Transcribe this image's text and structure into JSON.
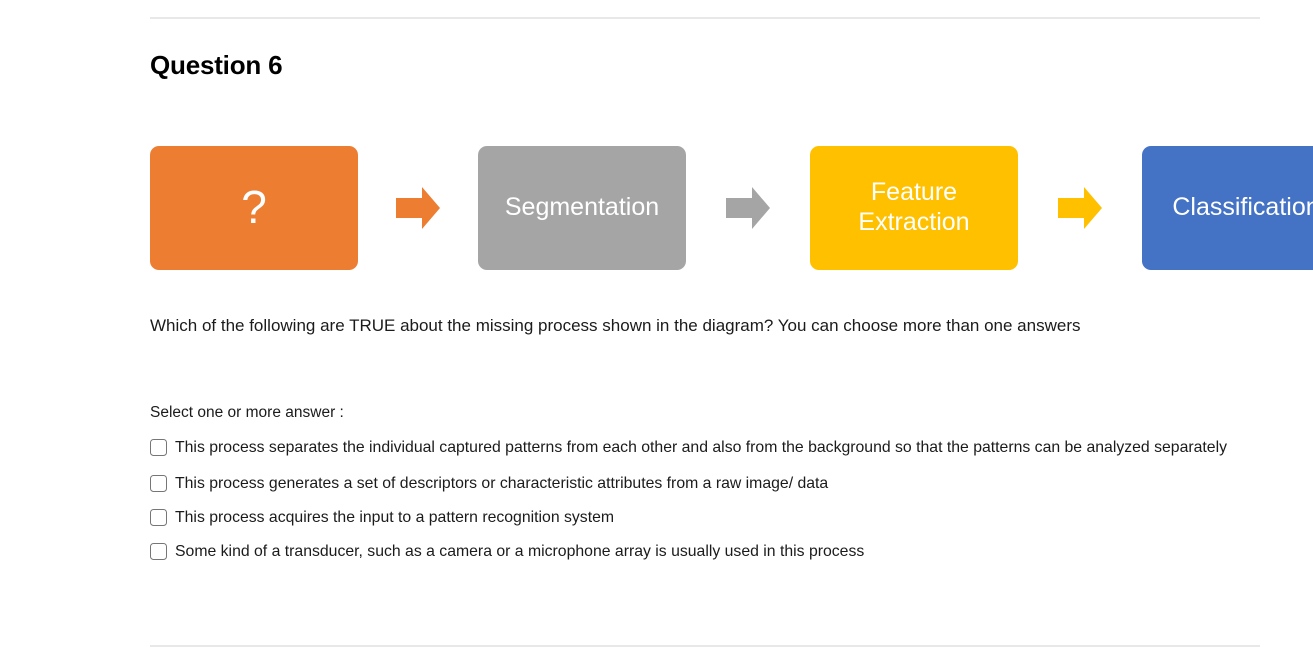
{
  "page": {
    "title": "Question 6"
  },
  "diagram": {
    "steps": [
      {
        "label": "?",
        "color": "#ED7D31",
        "name": "missing-process-box"
      },
      {
        "label": "Segmentation",
        "color": "#A5A5A5",
        "name": "segmentation-box"
      },
      {
        "label": "Feature Extraction",
        "color": "#FFC000",
        "name": "feature-extraction-box"
      },
      {
        "label": "Classification",
        "color": "#4472C4",
        "name": "classification-box"
      }
    ],
    "arrows": [
      {
        "color": "#ED7D31",
        "name": "arrow-1"
      },
      {
        "color": "#A5A5A5",
        "name": "arrow-2"
      },
      {
        "color": "#FFC000",
        "name": "arrow-3"
      }
    ]
  },
  "question": {
    "prompt": "Which of the following are TRUE about the missing process shown in the diagram? You can choose more than one answers",
    "select_hint": "Select one or more answer :",
    "options": [
      {
        "label": "This process separates the individual captured patterns from each other and also from the background so that the patterns can be analyzed separately",
        "checked": false
      },
      {
        "label": "This process generates a set of descriptors or characteristic attributes from a raw image/ data",
        "checked": false
      },
      {
        "label": "This process acquires the input to a pattern recognition system",
        "checked": false
      },
      {
        "label": "Some kind of a transducer, such as a camera or a microphone array is usually used in this process",
        "checked": false
      }
    ]
  }
}
